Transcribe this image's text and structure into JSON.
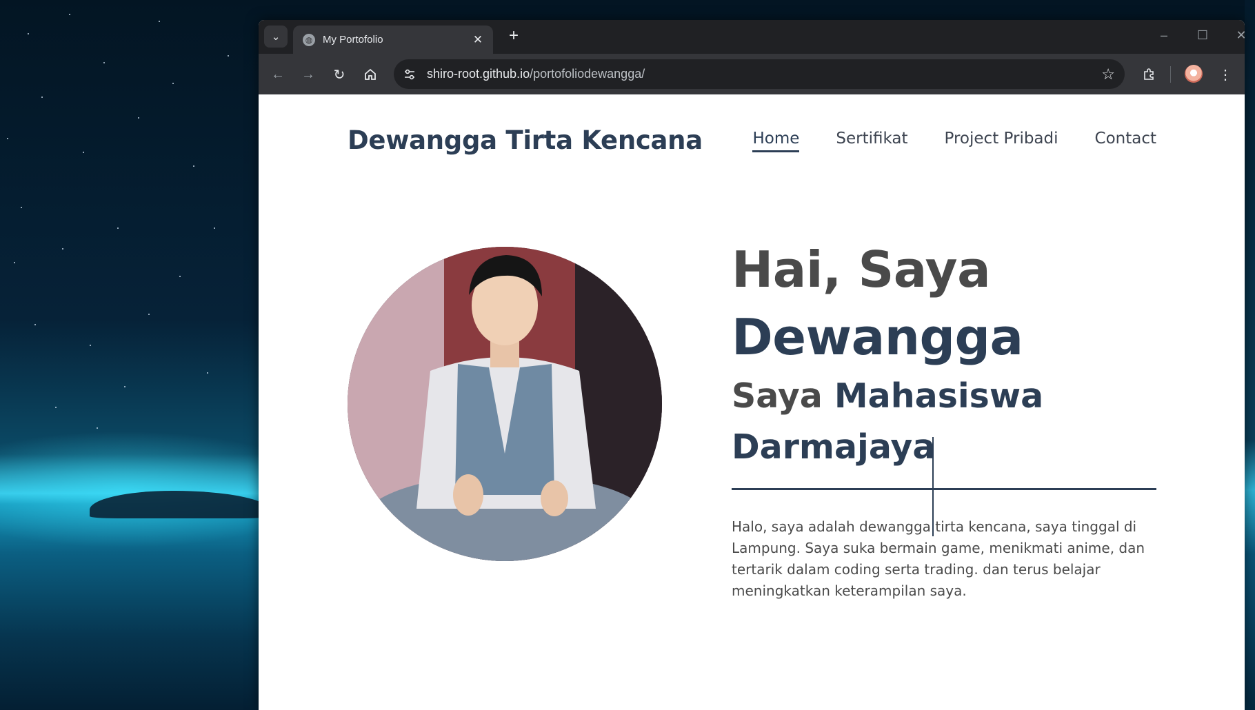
{
  "browser": {
    "tab_title": "My Portofolio",
    "url_host": "shiro-root.github.io",
    "url_path": "/portofoliodewangga/"
  },
  "site": {
    "brand": "Dewangga Tirta Kencana",
    "nav": [
      {
        "label": "Home",
        "active": true
      },
      {
        "label": "Sertifikat",
        "active": false
      },
      {
        "label": "Project Pribadi",
        "active": false
      },
      {
        "label": "Contact",
        "active": false
      }
    ],
    "hero": {
      "greeting": "Hai, Saya",
      "name": "Dewangga",
      "subtitle_lead": "Saya",
      "subtitle_rest_line1": "Mahasiswa",
      "subtitle_line2": "Darmajaya",
      "bio": "Halo, saya adalah dewangga tirta kencana, saya tinggal di Lampung. Saya suka bermain game, menikmati anime, dan tertarik dalam coding serta trading. dan terus belajar meningkatkan keterampilan saya."
    }
  },
  "colors": {
    "primary": "#2c3e55",
    "text_gray": "#4a4a4a",
    "browser_dark": "#202124",
    "browser_toolbar": "#35363a"
  },
  "icons": {
    "tab_search": "chevron-down-icon",
    "favicon": "globe-icon",
    "close": "close-icon",
    "new_tab": "plus-icon",
    "back": "arrow-left-icon",
    "forward": "arrow-right-icon",
    "reload": "reload-icon",
    "home": "home-icon",
    "site_info": "tune-icon",
    "bookmark": "star-icon",
    "extensions": "puzzle-icon",
    "menu": "kebab-menu-icon"
  }
}
